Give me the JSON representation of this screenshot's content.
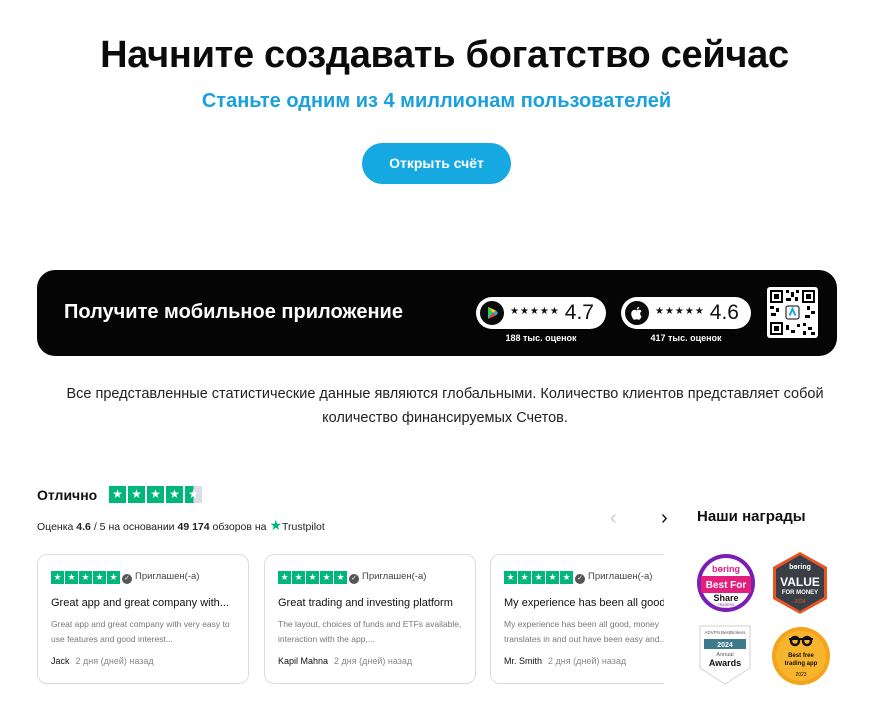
{
  "hero": {
    "title": "Начните создавать богатство сейчас",
    "subtitle": "Станьте одним из 4 миллионам пользователей",
    "cta_label": "Открыть счёт"
  },
  "app_banner": {
    "title": "Получите мобильное приложение",
    "stores": [
      {
        "name": "google-play",
        "stars": "★★★★★",
        "rating": "4.7",
        "caption": "188 тыс. оценок"
      },
      {
        "name": "app-store",
        "stars": "★★★★★",
        "rating": "4.6",
        "caption": "417 тыс. оценок"
      }
    ]
  },
  "disclaimer": "Все представленные статистические данные являются глобальными. Количество клиентов представляет собой количество финансируемых Счетов.",
  "trustpilot": {
    "label": "Отлично",
    "stars_value": 4.6,
    "summary_prefix": "Оценка",
    "score": "4.6",
    "scale": "/ 5",
    "summary_mid": "на основании",
    "reviews_count": "49 174",
    "summary_suffix": "обзоров на",
    "brand": "Trustpilot"
  },
  "reviews": [
    {
      "verified": "Приглашен(-а)",
      "title": "Great app and great company with...",
      "body": "Great app and great company with very easy to use features and good interest...",
      "author": "Jack",
      "date": "2 дня (дней) назад"
    },
    {
      "verified": "Приглашен(-а)",
      "title": "Great trading and investing platform",
      "body": "The layout, choices of funds and ETFs available, interaction with the app,...",
      "author": "Kapil Mahna",
      "date": "2 дня (дней) назад"
    },
    {
      "verified": "Приглашен(-а)",
      "title": "My experience has been all good",
      "body": "My experience has been all good, money translates in and out have been easy and...",
      "author": "Mr. Smith",
      "date": "2 дня (дней) назад"
    }
  ],
  "awards": {
    "title": "Наши награды",
    "items": [
      {
        "name": "boring-best-for-share",
        "brand": "bɵring",
        "line1": "Best For",
        "line2": "Share",
        "line3": "TRADERS",
        "line4": "2024"
      },
      {
        "name": "boring-value-for-money",
        "brand": "bɵring",
        "line1": "VALUE",
        "line2": "FOR MONEY",
        "line3": "2024"
      },
      {
        "name": "annual-awards",
        "brand": "ADVFN BestBrokers",
        "line1": "2024",
        "line2": "Annual",
        "line3": "Awards"
      },
      {
        "name": "best-free-trading-app",
        "line1": "Best free",
        "line2": "trading app",
        "line3": "2023"
      }
    ]
  },
  "colors": {
    "accent": "#16a8e0",
    "subtitle": "#1aa0dc",
    "trustpilot": "#00b67a",
    "banner": "#050505"
  }
}
